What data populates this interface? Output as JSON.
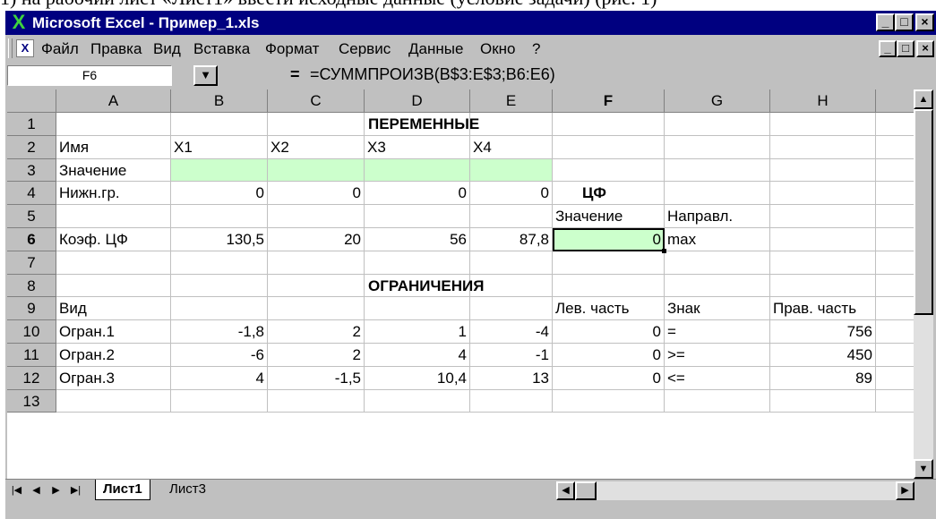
{
  "caption": "1) на рабочий лист «Лист1» ввести исходные данные (условие задачи) (рис. 1)",
  "window": {
    "title": "Microsoft Excel - Пример_1.xls",
    "controls": {
      "minimize": "_",
      "maximize": "□",
      "close": "×"
    }
  },
  "menu": [
    {
      "label": "Файл"
    },
    {
      "label": "Правка"
    },
    {
      "label": "Вид"
    },
    {
      "label": "Вставка"
    },
    {
      "label": "Формат"
    },
    {
      "label": "Сервис"
    },
    {
      "label": "Данные"
    },
    {
      "label": "Окно"
    },
    {
      "label": "?"
    }
  ],
  "formula_bar": {
    "name_box": "F6",
    "equals": "=",
    "formula": "=СУММПРОИЗВ(B$3:E$3;B6:E6)"
  },
  "columns": [
    "A",
    "B",
    "C",
    "D",
    "E",
    "F",
    "G",
    "H"
  ],
  "rows": [
    "1",
    "2",
    "3",
    "4",
    "5",
    "6",
    "7",
    "8",
    "9",
    "10",
    "11",
    "12",
    "13"
  ],
  "active_cell": "F6",
  "cells": {
    "D1": "ПЕРЕМЕННЫЕ",
    "A2": "Имя",
    "B2": "X1",
    "C2": "X2",
    "D2": "X3",
    "E2": "X4",
    "A3": "Значение",
    "A4": "Нижн.гр.",
    "B4": "0",
    "C4": "0",
    "D4": "0",
    "E4": "0",
    "F4": "ЦФ",
    "F5": "Значение",
    "G5": "Направл.",
    "A6": "Коэф. ЦФ",
    "B6": "130,5",
    "C6": "20",
    "D6": "56",
    "E6": "87,8",
    "F6": "0",
    "G6": "max",
    "D8": "ОГРАНИЧЕНИЯ",
    "A9": "Вид",
    "F9": "Лев. часть",
    "G9": "Знак",
    "H9": "Прав. часть",
    "A10": "Огран.1",
    "B10": "-1,8",
    "C10": "2",
    "D10": "1",
    "E10": "-4",
    "F10": "0",
    "G10": "=",
    "H10": "756",
    "A11": "Огран.2",
    "B11": "-6",
    "C11": "2",
    "D11": "4",
    "E11": "-1",
    "F11": "0",
    "G11": ">=",
    "H11": "450",
    "A12": "Огран.3",
    "B12": "4",
    "C12": "-1,5",
    "D12": "10,4",
    "E12": "13",
    "F12": "0",
    "G12": "<=",
    "H12": "89"
  },
  "colors": {
    "title_bar": "#000080",
    "input_fill": "#ccffcc",
    "chrome": "#c0c0c0",
    "excel_icon": "#3fd23f"
  },
  "sheets": [
    {
      "label": "Лист1",
      "active": true
    },
    {
      "label": "Лист3",
      "active": false
    }
  ]
}
